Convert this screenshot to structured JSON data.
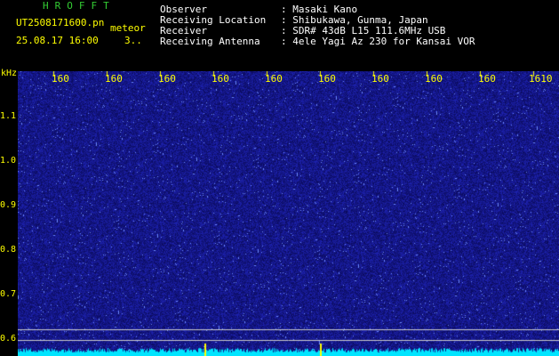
{
  "header": {
    "program_title": "HROFFT",
    "filename": "UT2508171600.pn",
    "filename_suffix": "meteor",
    "timestamp": "25.08.17 16:00",
    "extra_value": "3..",
    "labels": {
      "observer": "Observer",
      "location": "Receiving Location",
      "receiver": "Receiver",
      "antenna": "Receiving Antenna"
    },
    "values": {
      "observer": ": Masaki Kano",
      "location": ": Shibukawa, Gunma, Japan",
      "receiver": ": SDR# 43dB L15 111.6MHz USB",
      "antenna": ": 4ele Yagi Az 230 for Kansai VOR"
    }
  },
  "axes": {
    "y_unit": "kHz",
    "y_ticks": [
      "1.1",
      "1.0",
      "0.9",
      "0.8",
      "0.7",
      "0.6"
    ],
    "x_ticks": [
      "160",
      "160",
      "160",
      "160",
      "160",
      "160",
      "160",
      "160",
      "160",
      "1610"
    ]
  },
  "colors": {
    "background": "#000000",
    "spectrogram_base": "#10127e",
    "noise_highlight": "#3a5cff",
    "axis_text": "#ffff00",
    "title_green": "#33cc33",
    "baseline_cyan": "#00e5ff"
  }
}
